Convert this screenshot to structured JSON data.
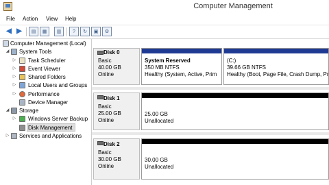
{
  "window": {
    "title": "Computer Management",
    "controls": {
      "minimize": "—",
      "maximize": "□",
      "close": "✕"
    }
  },
  "menu": [
    "File",
    "Action",
    "View",
    "Help"
  ],
  "toolbar": {
    "buttons": [
      "back-arrow-icon",
      "forward-arrow-icon",
      "up-folder-icon",
      "show-hide-tree-icon",
      "help-icon",
      "refresh-icon",
      "properties-icon",
      "export-list-icon"
    ]
  },
  "tree": {
    "root": "Computer Management (Local)",
    "system_tools": "System Tools",
    "task_scheduler": "Task Scheduler",
    "event_viewer": "Event Viewer",
    "shared_folders": "Shared Folders",
    "local_users": "Local Users and Groups",
    "performance": "Performance",
    "device_manager": "Device Manager",
    "storage": "Storage",
    "windows_server_backup": "Windows Server Backup",
    "disk_management": "Disk Management",
    "services": "Services and Applications"
  },
  "disks": [
    {
      "name": "Disk 0",
      "type": "Basic",
      "size": "40.00 GB",
      "status": "Online",
      "partitions": [
        {
          "label": "System Reserved",
          "detail": "350 MB NTFS",
          "health": "Healthy (System, Active, Prim"
        },
        {
          "label": "(C:)",
          "detail": "39.66 GB NTFS",
          "health": "Healthy (Boot, Page File, Crash Dump, Prin"
        }
      ]
    },
    {
      "name": "Disk 1",
      "type": "Basic",
      "size": "25.00 GB",
      "status": "Online",
      "partitions": [
        {
          "detail": "25.00 GB",
          "health": "Unallocated"
        }
      ]
    },
    {
      "name": "Disk 2",
      "type": "Basic",
      "size": "30.00 GB",
      "status": "Online",
      "partitions": [
        {
          "detail": "30.00 GB",
          "health": "Unallocated"
        }
      ]
    }
  ],
  "colors": {
    "primary_partition_bar": "#1f3a93",
    "unallocated_bar": "#000000",
    "disk_info_bg": "#f0f0f0"
  }
}
